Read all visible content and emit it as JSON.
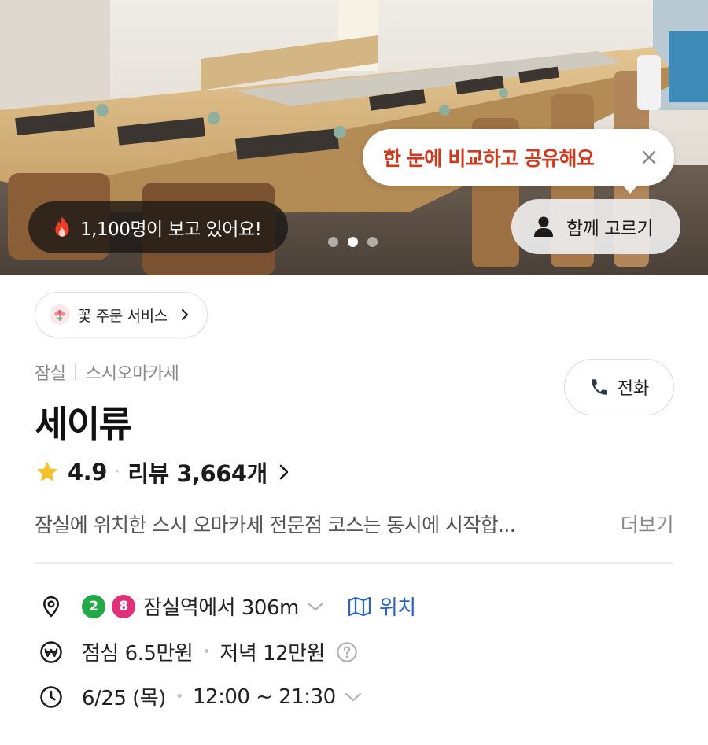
{
  "hero": {
    "viewers_text": "1,100명이 보고 있어요!",
    "carousel": {
      "total": 3,
      "active_index": 1
    },
    "tooltip_text": "한 눈에 비교하고 공유해요",
    "choose_together_label": "함께 고르기"
  },
  "chip": {
    "label": "꽃 주문 서비스"
  },
  "store": {
    "area": "잠실",
    "category": "스시오마카세",
    "name": "세이류",
    "rating": "4.9",
    "reviews_label": "리뷰 3,664개",
    "call_label": "전화",
    "description": "잠실에 위치한 스시 오마카세 전문점 코스는 동시에 시작합...",
    "more_label": "더보기"
  },
  "info": {
    "lines": [
      {
        "number": "2",
        "color": "#22a845"
      },
      {
        "number": "8",
        "color": "#e0307a"
      }
    ],
    "distance_text": "잠실역에서 306m",
    "map_label": "위치",
    "lunch_price": "점심 6.5만원",
    "dinner_price": "저녁 12만원",
    "date": "6/25 (목)",
    "hours": "12:00 ~ 21:30"
  },
  "colors": {
    "tooltip_accent": "#d4381c",
    "link_blue": "#2a63c4",
    "star": "#f4c12a"
  },
  "icons": {
    "viewers": "flame-icon",
    "tooltip_close": "close-icon",
    "choose_together": "person-icon",
    "chip": "flower-icon",
    "call": "phone-icon",
    "rating": "star-icon",
    "location": "location-pin-icon",
    "map": "map-icon",
    "price": "won-coin-icon",
    "price_help": "help-icon",
    "hours": "clock-icon"
  }
}
